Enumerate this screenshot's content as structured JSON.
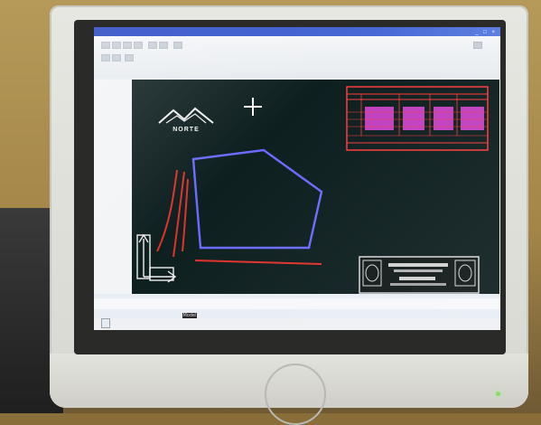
{
  "scene": {
    "description_colors": {
      "wall": "#a48648",
      "monitor_bezel": "#e3e3dd",
      "screen_background": "#e8eef4",
      "drawing_canvas": "#0e1f20",
      "polygon_stroke": "#6b6bff",
      "road_lines": "#e0322a",
      "table_frame": "#ff3b3b",
      "table_cells": "#d645d6",
      "titlebar": "#1f3fbf"
    }
  },
  "window": {
    "title": "",
    "controls": "_ □ ×"
  },
  "drawing": {
    "north_arrow_label": "NORTE",
    "model_tab": "Model",
    "ucs_icon": "ucs-icon",
    "crosshair_icon": "crosshair-icon"
  },
  "statusbar": {
    "start_label": ""
  }
}
